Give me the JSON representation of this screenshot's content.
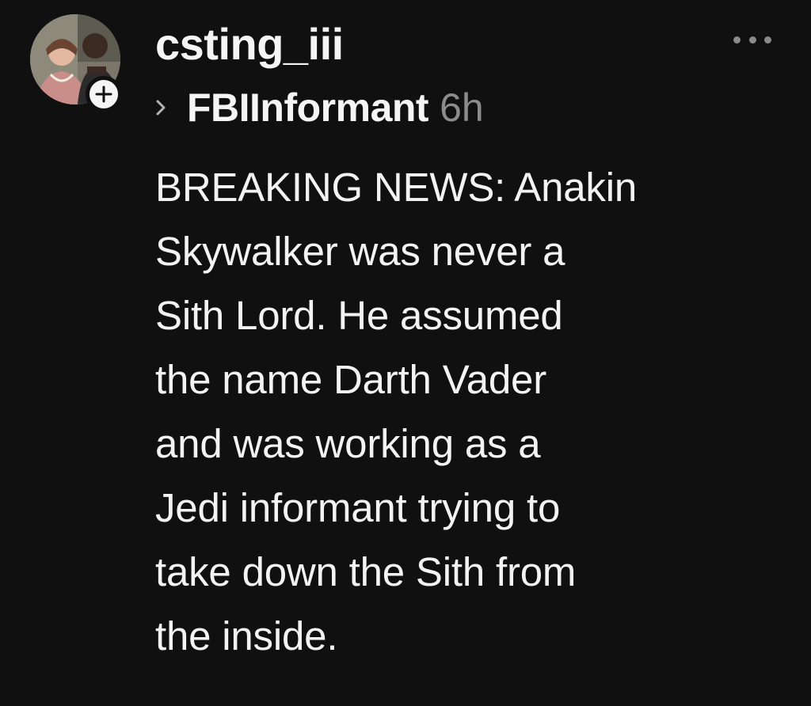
{
  "post": {
    "username": "csting_iii",
    "reply_to": "FBIInformant",
    "timestamp": "6h",
    "body": "BREAKING NEWS: Anakin\nSkywalker was never a\nSith Lord. He assumed\nthe name Darth Vader\nand was working as a\nJedi informant trying to\ntake down the Sith from\nthe inside.",
    "avatar_icon": "profile-photo",
    "follow_icon": "plus-icon",
    "more_icon": "more-options-icon",
    "reply_icon": "chevron-right-icon"
  },
  "colors": {
    "background": "#101010",
    "text": "#f3f3f3",
    "muted": "#8c8c8c"
  }
}
